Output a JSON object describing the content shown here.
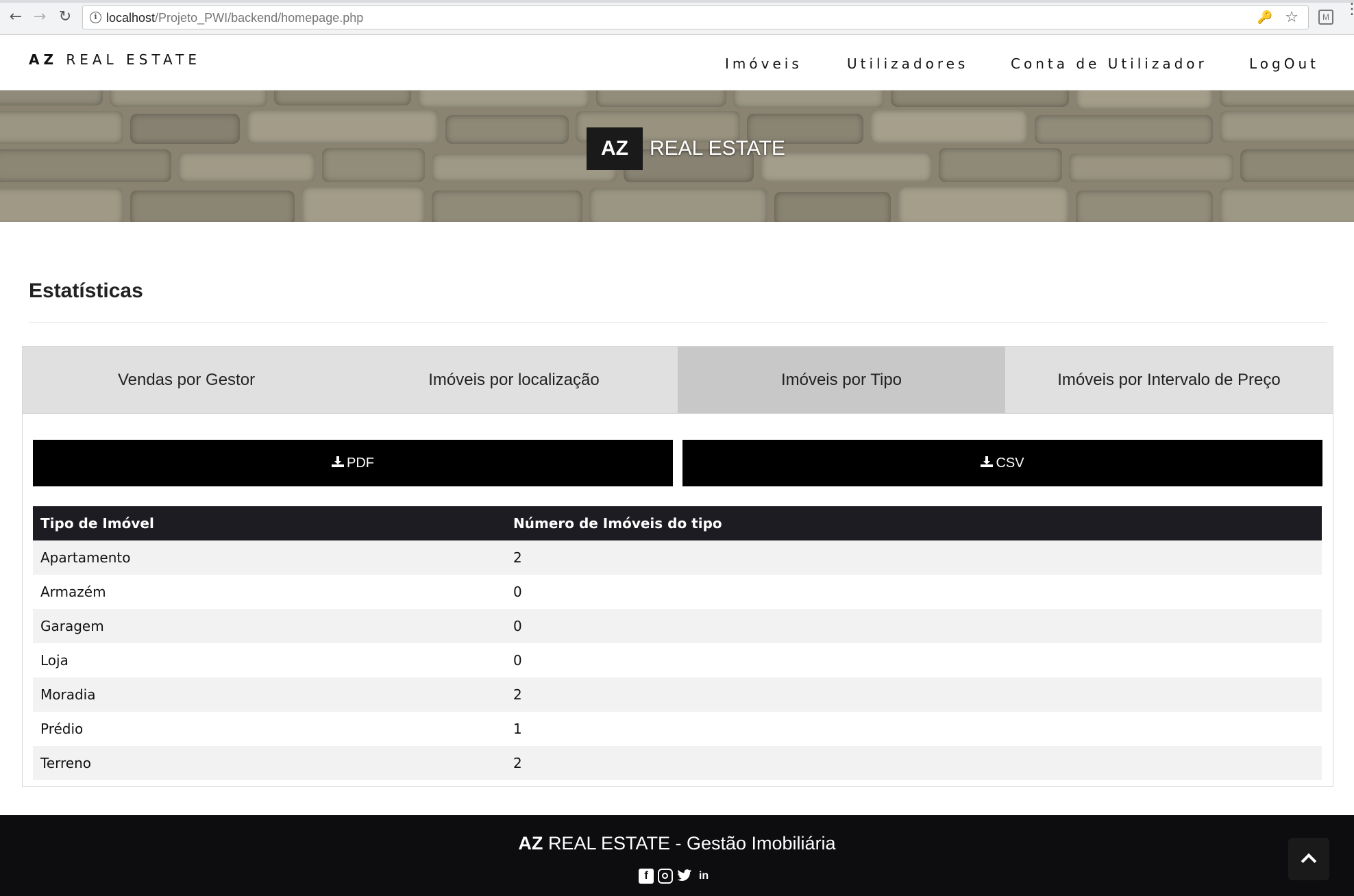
{
  "browser": {
    "url_host": "localhost",
    "url_path": "/Projeto_PWI/backend/homepage.php"
  },
  "header": {
    "brand_bold": "AZ",
    "brand_rest": "REAL ESTATE",
    "nav": [
      {
        "label": "Imóveis"
      },
      {
        "label": "Utilizadores"
      },
      {
        "label": "Conta de Utilizador"
      },
      {
        "label": "LogOut"
      }
    ]
  },
  "hero": {
    "logo_box": "AZ",
    "logo_text": "REAL ESTATE"
  },
  "section": {
    "title": "Estatísticas"
  },
  "tabs": [
    {
      "label": "Vendas por Gestor",
      "active": false
    },
    {
      "label": "Imóveis por localização",
      "active": false
    },
    {
      "label": "Imóveis por Tipo",
      "active": true
    },
    {
      "label": "Imóveis por Intervalo de Preço",
      "active": false
    }
  ],
  "downloads": {
    "pdf_label": "PDF",
    "csv_label": "CSV"
  },
  "table": {
    "headers": [
      "Tipo de Imóvel",
      "Número de Imóveis do tipo"
    ],
    "rows": [
      [
        "Apartamento",
        "2"
      ],
      [
        "Armazém",
        "0"
      ],
      [
        "Garagem",
        "0"
      ],
      [
        "Loja",
        "0"
      ],
      [
        "Moradia",
        "2"
      ],
      [
        "Prédio",
        "1"
      ],
      [
        "Terreno",
        "2"
      ]
    ]
  },
  "footer": {
    "title_bold": "AZ",
    "title_rest": "REAL ESTATE - Gestão Imobiliária",
    "social": [
      {
        "icon": "facebook-icon"
      },
      {
        "icon": "instagram-icon"
      },
      {
        "icon": "twitter-icon"
      },
      {
        "icon": "linkedin-icon"
      }
    ]
  },
  "colors": {
    "dark": "#000000",
    "tab_bg": "#e0e0e0",
    "tab_active": "#c8c8c8",
    "footer_bg": "#0d0d0f"
  }
}
